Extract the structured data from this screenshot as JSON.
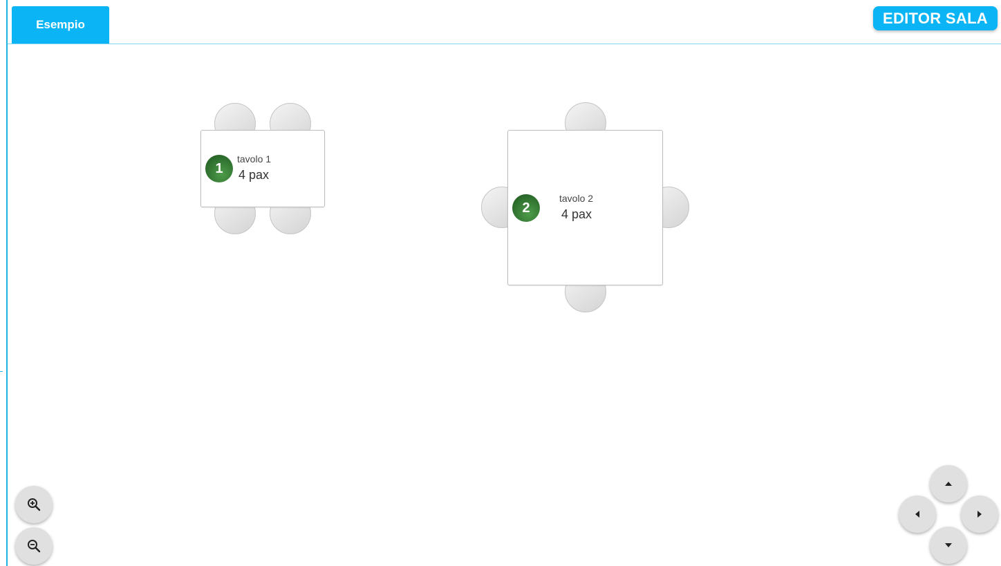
{
  "tabs": [
    {
      "label": "Esempio",
      "active": true
    }
  ],
  "header": {
    "editor_button_label": "EDITOR SALA"
  },
  "tables": [
    {
      "number": "1",
      "name": "tavolo 1",
      "pax": "4 pax"
    },
    {
      "number": "2",
      "name": "tavolo 2",
      "pax": "4 pax"
    }
  ],
  "zoom_controls": [
    {
      "icon": "zoom-in-icon"
    },
    {
      "icon": "zoom-out-icon"
    }
  ],
  "pan_controls": [
    {
      "icon": "arrow-up-icon"
    },
    {
      "icon": "arrow-left-icon"
    },
    {
      "icon": "arrow-right-icon"
    },
    {
      "icon": "arrow-down-icon"
    }
  ],
  "colors": {
    "accent": "#0ab4f5",
    "badge_green": "#2f6f2f",
    "rail": "#1fb3e3"
  }
}
